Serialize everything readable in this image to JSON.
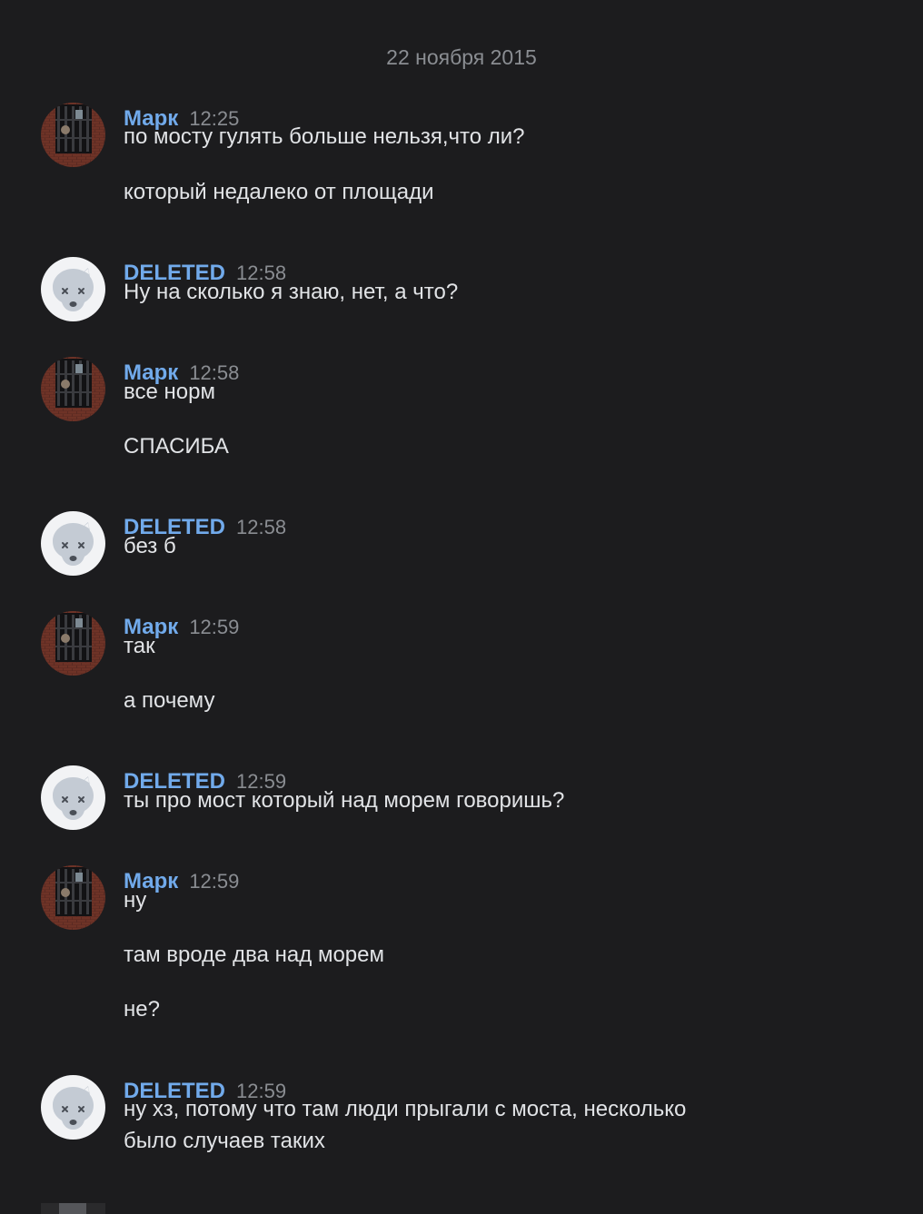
{
  "date_separator": "22 ноября 2015",
  "colors": {
    "background": "#1c1c1e",
    "author": "#71aaeb",
    "time": "#8a8d92",
    "text": "#e1e3e6"
  },
  "users": {
    "mark": {
      "name": "Марк",
      "avatar_icon": "photo-avatar"
    },
    "deleted": {
      "name": "DELETED",
      "avatar_icon": "deleted-dog-icon"
    }
  },
  "groups": [
    {
      "user": "mark",
      "time": "12:25",
      "lines": [
        "по мосту гулять больше нельзя,что ли?",
        "который недалеко от площади"
      ]
    },
    {
      "user": "deleted",
      "time": "12:58",
      "lines": [
        "Ну на сколько я знаю, нет, а что?"
      ]
    },
    {
      "user": "mark",
      "time": "12:58",
      "lines": [
        "все норм",
        "СПАСИБА"
      ]
    },
    {
      "user": "deleted",
      "time": "12:58",
      "lines": [
        "без б"
      ]
    },
    {
      "user": "mark",
      "time": "12:59",
      "lines": [
        "так",
        "а почему"
      ]
    },
    {
      "user": "deleted",
      "time": "12:59",
      "lines": [
        "ты про мост который над морем говоришь?"
      ]
    },
    {
      "user": "mark",
      "time": "12:59",
      "lines": [
        "ну",
        "там вроде два над морем",
        "не?"
      ]
    },
    {
      "user": "deleted",
      "time": "12:59",
      "lines": [
        "ну хз, потому что там люди прыгали с моста, несколько",
        "было случаев таких"
      ]
    }
  ]
}
